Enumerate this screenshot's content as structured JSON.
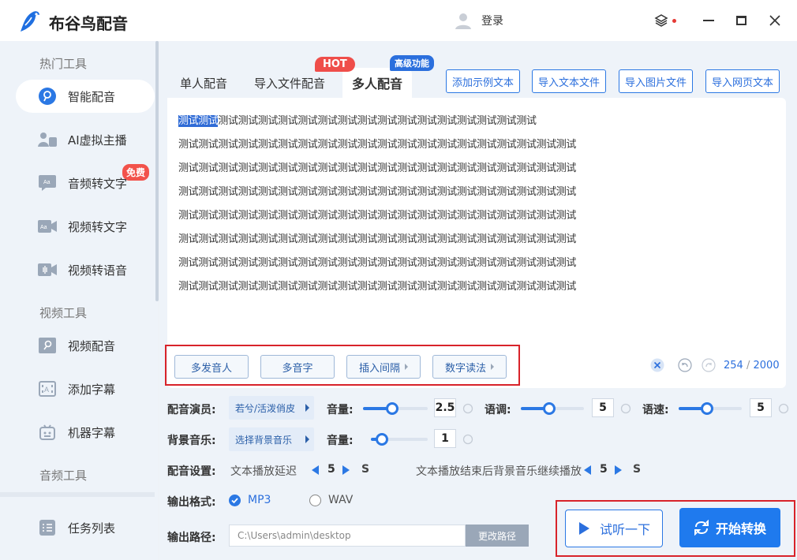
{
  "app": {
    "title": "布谷鸟配音",
    "login_label": "登录"
  },
  "sidebar": {
    "groups": [
      "热门工具",
      "视频工具",
      "音频工具"
    ],
    "items": [
      {
        "label": "智能配音",
        "icon": "smart-dub-icon",
        "active": true
      },
      {
        "label": "AI虚拟主播",
        "icon": "virtual-anchor-icon",
        "badge": "免费"
      },
      {
        "label": "音频转文字",
        "icon": "audio-to-text-icon"
      },
      {
        "label": "视频转文字",
        "icon": "video-to-text-icon"
      },
      {
        "label": "视频转语音",
        "icon": "video-to-voice-icon"
      },
      {
        "label": "视频配音",
        "icon": "video-dub-icon"
      },
      {
        "label": "添加字幕",
        "icon": "add-subtitle-icon"
      },
      {
        "label": "机器字幕",
        "icon": "robot-subtitle-icon"
      }
    ],
    "task_list": "任务列表"
  },
  "tabs": {
    "items": [
      "单人配音",
      "导入文件配音",
      "多人配音"
    ],
    "active": "多人配音",
    "hot_badge": "HOT",
    "adv_badge": "高级功能"
  },
  "import_buttons": [
    "添加示例文本",
    "导入文本文件",
    "导入图片文件",
    "导入网页文本"
  ],
  "editor": {
    "selected_prefix": "测试测试",
    "first_line_rest": "测试测试测试测试测试测试测试测试测试测试测试测试测试测试测试测试",
    "lines": [
      "测试测试测试测试测试测试测试测试测试测试测试测试测试测试测试测试测试测试测试测试",
      "测试测试测试测试测试测试测试测试测试测试测试测试测试测试测试测试测试测试测试测试",
      "测试测试测试测试测试测试测试测试测试测试测试测试测试测试测试测试测试测试测试测试",
      "测试测试测试测试测试测试测试测试测试测试测试测试测试测试测试测试测试测试测试测试",
      "测试测试测试测试测试测试测试测试测试测试测试测试测试测试测试测试测试测试测试测试",
      "测试测试测试测试测试测试测试测试测试测试测试测试测试测试测试测试测试测试测试测试",
      "测试测试测试测试测试测试测试测试测试测试测试测试测试测试测试测试测试测试测试测试"
    ],
    "tool_buttons": [
      "多发音人",
      "多音字",
      "插入间隔",
      "数字读法"
    ],
    "count": "254",
    "count_sep": "/",
    "count_max": "2000"
  },
  "voice": {
    "actor_label": "配音演员:",
    "actor_value": "若兮/活泼俏皮",
    "volume_label": "音量:",
    "volume_value": "2.5",
    "volume_fraction": 0.45,
    "pitch_label": "语调:",
    "pitch_value": "5",
    "pitch_fraction": 0.45,
    "speed_label": "语速:",
    "speed_value": "5",
    "speed_fraction": 0.45
  },
  "bgm": {
    "label": "背景音乐:",
    "value": "选择背景音乐",
    "volume_label": "音量:",
    "volume_value": "1",
    "volume_fraction": 0.2
  },
  "settings": {
    "label": "配音设置:",
    "delay_label": "文本播放延迟",
    "delay_value": "5",
    "delay_unit": "S",
    "continue_label": "文本播放结束后背景音乐继续播放",
    "continue_value": "5",
    "continue_unit": "S"
  },
  "output": {
    "format_label": "输出格式:",
    "formats": [
      "MP3",
      "WAV"
    ],
    "selected": "MP3",
    "path_label": "输出路径:",
    "path_value": "C:\\Users\\admin\\desktop",
    "change_path": "更改路径"
  },
  "actions": {
    "preview": "试听一下",
    "start": "开始转换"
  },
  "colors": {
    "accent": "#2b78e4",
    "highlight": "#d8232a",
    "hot": "#ef4e4a"
  }
}
